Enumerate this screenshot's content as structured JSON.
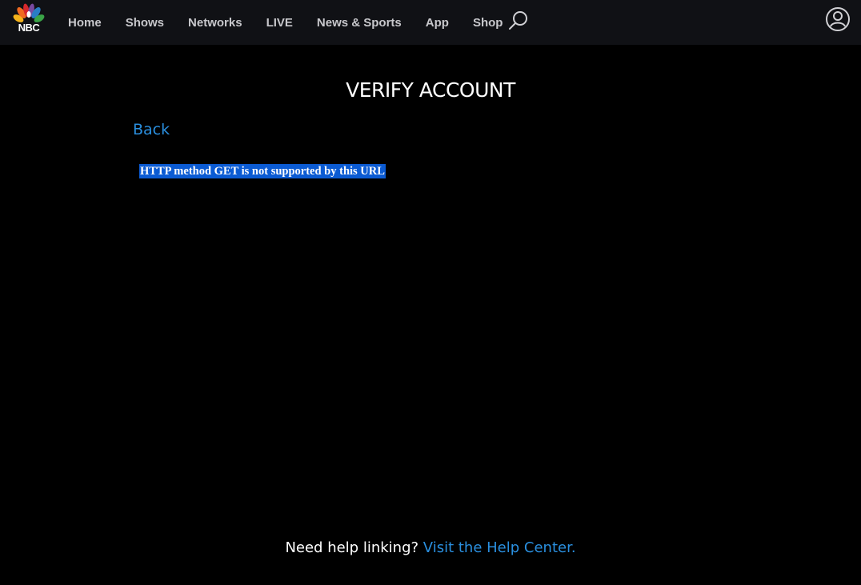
{
  "header": {
    "logo_text": "NBC",
    "logo_icon": "peacock-logo-icon",
    "nav": [
      {
        "label": "Home"
      },
      {
        "label": "Shows"
      },
      {
        "label": "Networks"
      },
      {
        "label": "LIVE"
      },
      {
        "label": "News & Sports"
      },
      {
        "label": "App"
      },
      {
        "label": "Shop"
      }
    ],
    "search_icon": "search-icon",
    "account_icon": "user-account-icon"
  },
  "main": {
    "title": "VERIFY ACCOUNT",
    "back_label": "Back",
    "error_message": "HTTP method GET is not supported by this URL"
  },
  "footer": {
    "help_prefix": "Need help linking?",
    "help_link": "Visit the Help Center."
  },
  "colors": {
    "background": "#000000",
    "topbar": "#101115",
    "link": "#2a8fdf",
    "selection": "#0b5bd3"
  }
}
